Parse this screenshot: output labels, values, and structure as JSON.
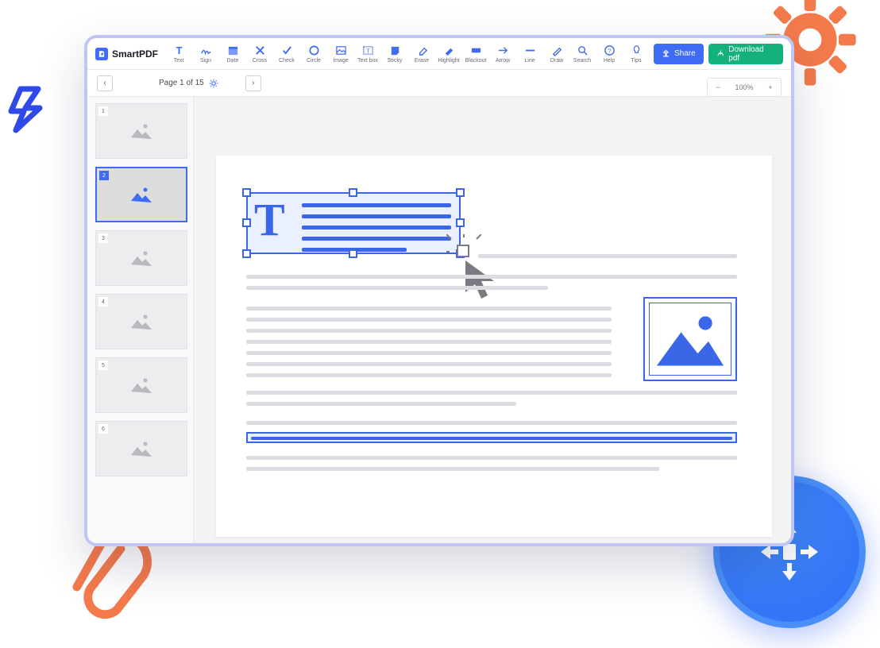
{
  "app": {
    "name": "SmartPDF"
  },
  "toolbar": {
    "tools": [
      {
        "id": "text",
        "label": "Text"
      },
      {
        "id": "sign",
        "label": "Sign"
      },
      {
        "id": "date",
        "label": "Date"
      },
      {
        "id": "cross",
        "label": "Cross"
      },
      {
        "id": "check",
        "label": "Check"
      },
      {
        "id": "circle",
        "label": "Circle"
      },
      {
        "id": "image",
        "label": "Image"
      },
      {
        "id": "textbox",
        "label": "Text box"
      },
      {
        "id": "sticky",
        "label": "Sticky"
      },
      {
        "id": "erase",
        "label": "Erase"
      },
      {
        "id": "highlight",
        "label": "Highlight"
      },
      {
        "id": "blackout",
        "label": "Blackout"
      },
      {
        "id": "arrow",
        "label": "Arrow"
      },
      {
        "id": "line",
        "label": "Line"
      },
      {
        "id": "draw",
        "label": "Draw"
      }
    ],
    "help": [
      {
        "id": "search",
        "label": "Search"
      },
      {
        "id": "help",
        "label": "Help"
      },
      {
        "id": "tips",
        "label": "Tips"
      }
    ],
    "share": "Share",
    "download": "Download pdf"
  },
  "pagebar": {
    "indicator": "Page 1 of 15"
  },
  "zoom": {
    "value": "100%"
  },
  "thumbs": [
    1,
    2,
    3,
    4,
    5,
    6
  ],
  "active_thumb": 2,
  "colors": {
    "primary": "#3f6cf5",
    "success": "#14b27a",
    "accent": "#f47a4b"
  }
}
